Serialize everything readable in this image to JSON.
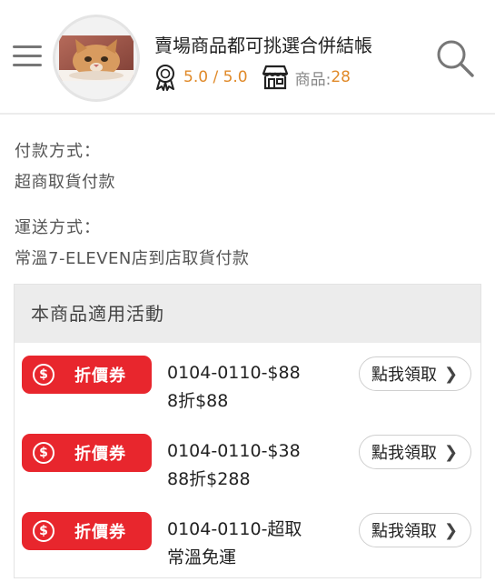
{
  "header": {
    "shop_title": "賣場商品都可挑選合併結帳",
    "rating_value": "5.0 / 5.0",
    "products_label": "商品:",
    "products_count": "28"
  },
  "info": {
    "payment_label": "付款方式：",
    "payment_value": "超商取貨付款",
    "shipping_label": "運送方式：",
    "shipping_value": "常溫7-ELEVEN店到店取貨付款"
  },
  "promotions": {
    "header": "本商品適用活動",
    "coupons": [
      {
        "badge": "折價券",
        "line1": "0104-0110-$88",
        "line2": "8折$88",
        "button": "點我領取"
      },
      {
        "badge": "折價券",
        "line1": "0104-0110-$38",
        "line2": "88折$288",
        "button": "點我領取"
      },
      {
        "badge": "折價券",
        "line1": "0104-0110-超取",
        "line2": "常溫免運",
        "button": "點我領取"
      }
    ]
  },
  "colors": {
    "accent_orange": "#e08a2a",
    "coupon_red": "#e8262d"
  }
}
